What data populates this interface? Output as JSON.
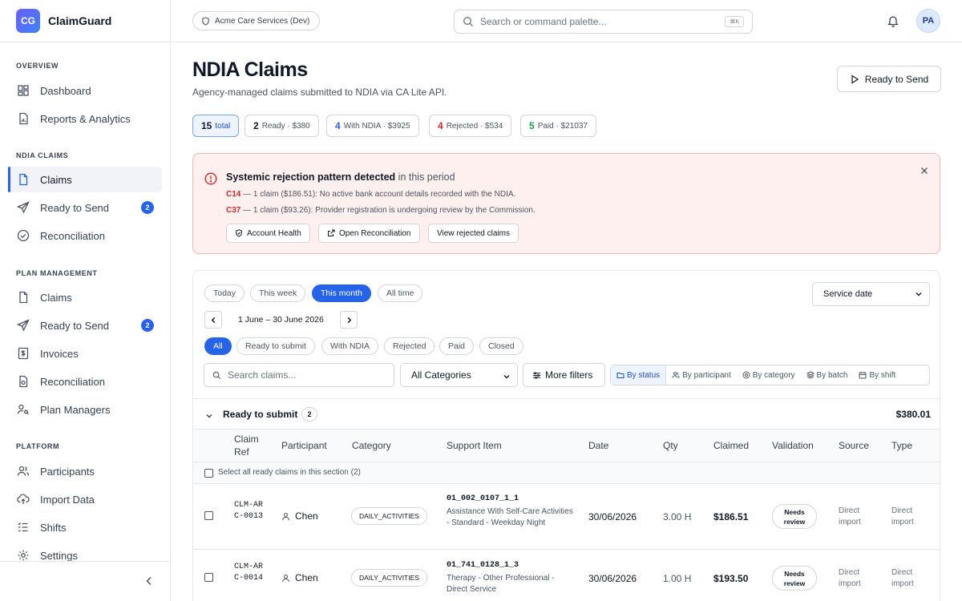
{
  "brand": {
    "initials": "CG",
    "name": "ClaimGuard"
  },
  "sidebar": {
    "sections": [
      {
        "title": "OVERVIEW"
      },
      {
        "title": "NDIA CLAIMS"
      },
      {
        "title": "PLAN MANAGEMENT"
      },
      {
        "title": "PLATFORM"
      }
    ],
    "items": [
      {
        "label": "Dashboard",
        "icon": "grid-icon"
      },
      {
        "label": "Reports & Analytics",
        "icon": "report-icon"
      },
      {
        "label": "Claims",
        "icon": "document-icon",
        "active": true
      },
      {
        "label": "Ready to Send",
        "icon": "send-icon",
        "badge": "2"
      },
      {
        "label": "Reconciliation",
        "icon": "check-circle-icon"
      },
      {
        "label": "Claims",
        "icon": "document-icon"
      },
      {
        "label": "Ready to Send",
        "icon": "send-icon",
        "badge": "2"
      },
      {
        "label": "Invoices",
        "icon": "invoice-icon"
      },
      {
        "label": "Reconciliation",
        "icon": "reconcile-doc-icon"
      },
      {
        "label": "Plan Managers",
        "icon": "user-key-icon"
      },
      {
        "label": "Participants",
        "icon": "users-icon"
      },
      {
        "label": "Import Data",
        "icon": "cloud-upload-icon"
      },
      {
        "label": "Shifts",
        "icon": "list-icon"
      },
      {
        "label": "Settings",
        "icon": "gear-icon"
      }
    ]
  },
  "topbar": {
    "org": "Acme Care Services (Dev)",
    "search_placeholder": "Search or command palette...",
    "shortcut": "⌘K",
    "avatar": "PA"
  },
  "page": {
    "title": "NDIA Claims",
    "subtitle": "Agency-managed claims submitted to NDIA via CA Lite API.",
    "action_label": "Ready to Send"
  },
  "stats": [
    {
      "count": "15",
      "label": "total",
      "color": "#111827",
      "active": true
    },
    {
      "count": "2",
      "label": "Ready · $380",
      "color": "#111827"
    },
    {
      "count": "4",
      "label": "With NDIA · $3925",
      "color": "#2563eb"
    },
    {
      "count": "4",
      "label": "Rejected · $534",
      "color": "#dc2626"
    },
    {
      "count": "5",
      "label": "Paid · $21037",
      "color": "#16a34a"
    }
  ],
  "alert": {
    "title": "Systemic rejection pattern detected",
    "title_suffix": " in this period",
    "lines": [
      {
        "code": "C14",
        "text": " — 1 claim ($186.51): No active bank account details recorded with the NDIA."
      },
      {
        "code": "C37",
        "text": " — 1 claim ($93.26): Provider registration is undergoing review by the Commission."
      }
    ],
    "buttons": [
      "Account Health",
      "Open Reconciliation",
      "View rejected claims"
    ]
  },
  "filters": {
    "periods": [
      "Today",
      "This week",
      "This month",
      "All time"
    ],
    "active_period": "This month",
    "date_basis": "Service date",
    "date_range": "1 June – 30 June 2026",
    "statuses": [
      "All",
      "Ready to submit",
      "With NDIA",
      "Rejected",
      "Paid",
      "Closed"
    ],
    "active_status": "All",
    "search_placeholder": "Search claims...",
    "category": "All Categories",
    "more_filters": "More filters",
    "group_by": [
      "By status",
      "By participant",
      "By category",
      "By batch",
      "By shift"
    ],
    "active_group": "By status"
  },
  "section": {
    "title": "Ready to submit",
    "count": "2",
    "total": "$380.01",
    "select_all": "Select all ready claims in this section (2)"
  },
  "columns": [
    "Claim Ref",
    "Participant",
    "Category",
    "Support Item",
    "Date",
    "Qty",
    "Claimed",
    "Validation",
    "Source",
    "Type"
  ],
  "rows": [
    {
      "ref": "CLM-ARC-0013",
      "participant": "Chen",
      "category": "DAILY_ACTIVITIES",
      "support_code": "01_002_0107_1_1",
      "support_desc": "Assistance With Self-Care Activities - Standard - Weekday Night",
      "date": "30/06/2026",
      "qty": "3.00 H",
      "claimed": "$186.51",
      "validation": "Needs review",
      "source": "Direct import",
      "type": "Direct import"
    },
    {
      "ref": "CLM-ARC-0014",
      "participant": "Chen",
      "category": "DAILY_ACTIVITIES",
      "support_code": "01_741_0128_1_3",
      "support_desc": "Therapy - Other Professional - Direct Service",
      "date": "30/06/2026",
      "qty": "1.00 H",
      "claimed": "$193.50",
      "validation": "Needs review",
      "source": "Direct import",
      "type": "Direct import"
    }
  ]
}
